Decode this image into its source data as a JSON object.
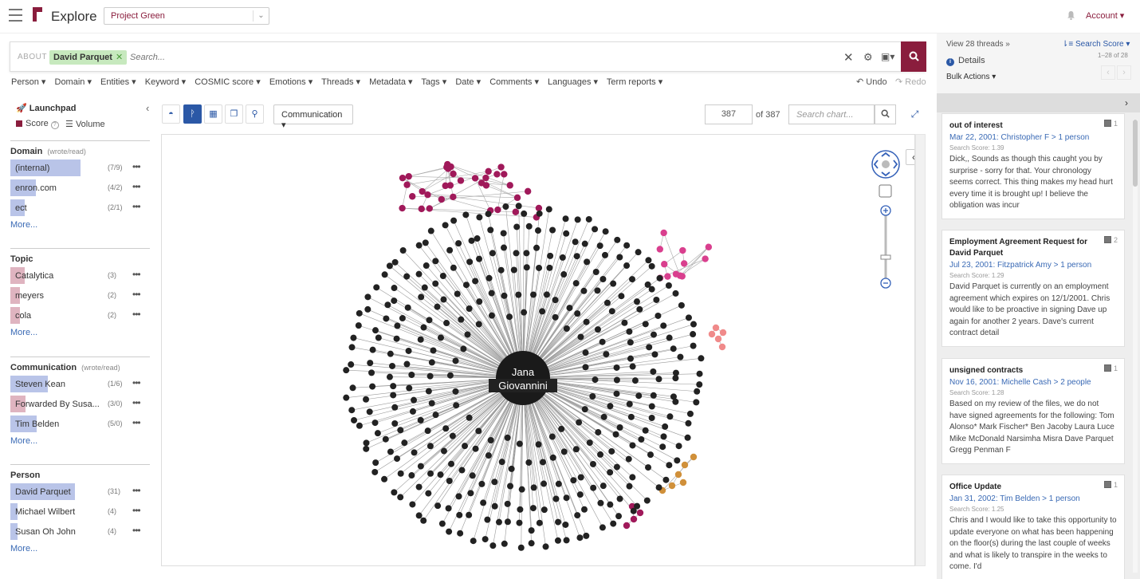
{
  "header": {
    "app_title": "Explore",
    "project": "Project Green",
    "account": "Account ▾"
  },
  "search": {
    "about_label": "ABOUT",
    "chip": "David Parquet",
    "placeholder": "Search..."
  },
  "filters": [
    "Person ▾",
    "Domain ▾",
    "Entities ▾",
    "Keyword ▾",
    "COSMIC score ▾",
    "Emotions ▾",
    "Threads ▾",
    "Metadata ▾",
    "Tags ▾",
    "Date ▾",
    "Comments ▾",
    "Languages ▾",
    "Term reports ▾"
  ],
  "undo_label": "Undo",
  "redo_label": "Redo",
  "launchpad": {
    "title": "Launchpad",
    "score_label": "Score",
    "volume_label": "Volume",
    "more_label": "More...",
    "sections": [
      {
        "title": "Domain",
        "sub": "(wrote/read)",
        "items": [
          {
            "label": "(internal)",
            "count": "(7/9)",
            "fill": 0.5,
            "color": "#b9c4e8"
          },
          {
            "label": "enron.com",
            "count": "(4/2)",
            "fill": 0.18,
            "color": "#b9c4e8"
          },
          {
            "label": "ect",
            "count": "(2/1)",
            "fill": 0.1,
            "color": "#b9c4e8"
          }
        ]
      },
      {
        "title": "Topic",
        "sub": "",
        "items": [
          {
            "label": "Catalytica",
            "count": "(3)",
            "fill": 0.1,
            "color": "#dfb4c0"
          },
          {
            "label": "meyers",
            "count": "(2)",
            "fill": 0.07,
            "color": "#dfb4c0"
          },
          {
            "label": "cola",
            "count": "(2)",
            "fill": 0.07,
            "color": "#dfb4c0"
          }
        ]
      },
      {
        "title": "Communication",
        "sub": "(wrote/read)",
        "items": [
          {
            "label": "Steven Kean",
            "count": "(1/6)",
            "fill": 0.27,
            "color": "#b9c4e8"
          },
          {
            "label": "Forwarded By Susa...",
            "count": "(3/0)",
            "fill": 0.11,
            "color": "#dfb4c0"
          },
          {
            "label": "Tim Belden",
            "count": "(5/0)",
            "fill": 0.19,
            "color": "#b9c4e8"
          }
        ]
      },
      {
        "title": "Person",
        "sub": "",
        "items": [
          {
            "label": "David Parquet",
            "count": "(31)",
            "fill": 0.46,
            "color": "#b9c4e8"
          },
          {
            "label": "Michael Wilbert",
            "count": "(4)",
            "fill": 0.05,
            "color": "#b9c4e8"
          },
          {
            "label": "Susan Oh John",
            "count": "(4)",
            "fill": 0.05,
            "color": "#b9c4e8"
          }
        ]
      }
    ]
  },
  "chart_toolbar": {
    "view_select": "Communication ▾",
    "node_count": "387",
    "of_total": "of 387",
    "search_placeholder": "Search chart..."
  },
  "graph": {
    "center_label_line1": "Jana",
    "center_label_line2": "Giovannini",
    "cluster_colors": {
      "magenta": "#a0195a",
      "pink": "#d93f8e",
      "salmon": "#f08a8a",
      "orange": "#d0903a",
      "node": "#222222"
    }
  },
  "threads_panel": {
    "view_threads": "View 28 threads »",
    "sort_label": "Search Score ▾",
    "range": "1–28 of 28",
    "details_label": "Details",
    "bulk_actions": "Bulk Actions ▾",
    "cards": [
      {
        "title": "out of interest",
        "count": "1",
        "meta": "Mar 22, 2001: Christopher F > 1 person",
        "score": "Search Score: 1.39",
        "body": "Dick,, Sounds as though this caught you by surprise - sorry for that. Your chronology seems correct. This thing makes my head hurt every time it is brought up! I believe the obligation was incur"
      },
      {
        "title": "Employment Agreement Request for David Parquet",
        "count": "2",
        "meta": "Jul 23, 2001: Fitzpatrick Amy > 1 person",
        "score": "Search Score: 1.29",
        "body": "David Parquet is currently on an employment agreement which expires on 12/1/2001. Chris would like to be proactive in signing Dave up again for another 2 years. Dave's current contract detail"
      },
      {
        "title": "unsigned contracts",
        "count": "1",
        "meta": "Nov 16, 2001: Michelle Cash > 2 people",
        "score": "Search Score: 1.28",
        "body": "Based on my review of the files, we do not have signed agreements for the following: Tom Alonso* Mark Fischer* Ben Jacoby Laura Luce Mike McDonald Narsimha Misra Dave Parquet Gregg Penman F"
      },
      {
        "title": "Office Update",
        "count": "1",
        "meta": "Jan 31, 2002: Tim Belden > 1 person",
        "score": "Search Score: 1.25",
        "body": "Chris and I would like to take this opportunity to update everyone on what has been happening on the floor(s) during the last couple of weeks and what is likely to transpire in the weeks to come. I'd"
      }
    ]
  }
}
